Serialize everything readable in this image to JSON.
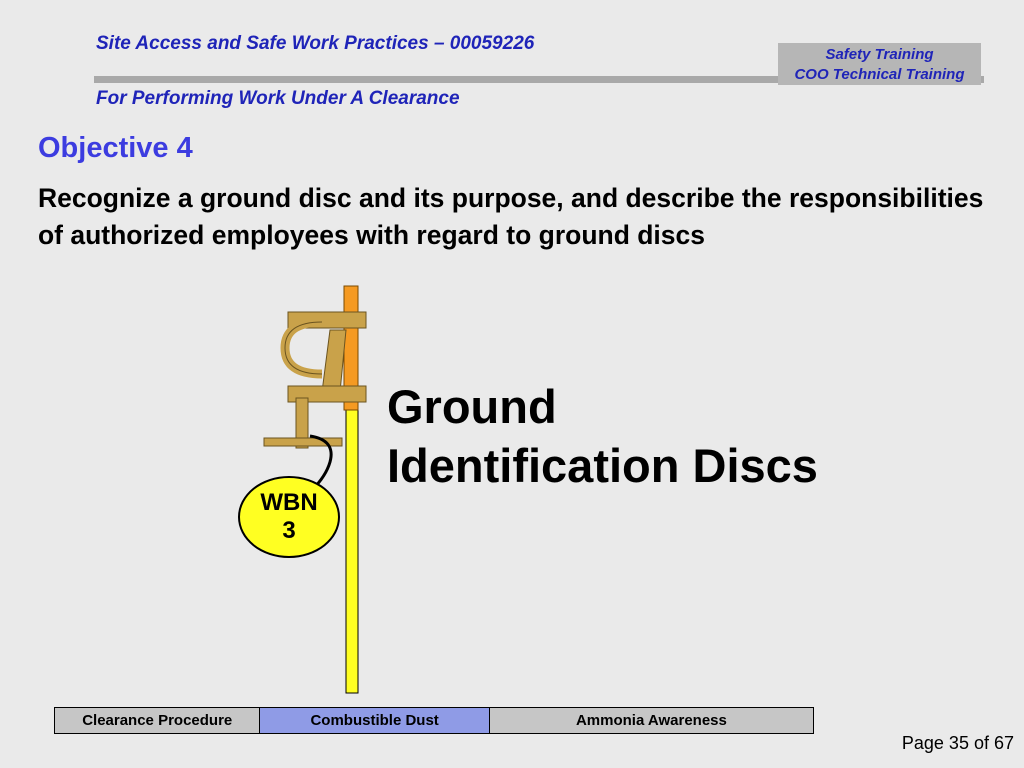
{
  "header": {
    "title": "Site Access and Safe Work Practices – 00059226",
    "subtitle": "For  Performing Work Under A Clearance",
    "badge_line1": "Safety Training",
    "badge_line2": "COO Technical Training"
  },
  "content": {
    "objective": "Objective 4",
    "description": "Recognize a ground disc and its purpose, and describe the responsibilities of authorized employees with regard to ground discs",
    "title_line1": "Ground",
    "title_line2": "Identification Discs",
    "disc_line1": "WBN",
    "disc_line2": "3"
  },
  "nav": {
    "tabs": [
      {
        "label": "Clearance Procedure"
      },
      {
        "label": "Combustible Dust"
      },
      {
        "label": "Ammonia Awareness"
      }
    ]
  },
  "footer": {
    "page": "Page 35 of 67"
  }
}
